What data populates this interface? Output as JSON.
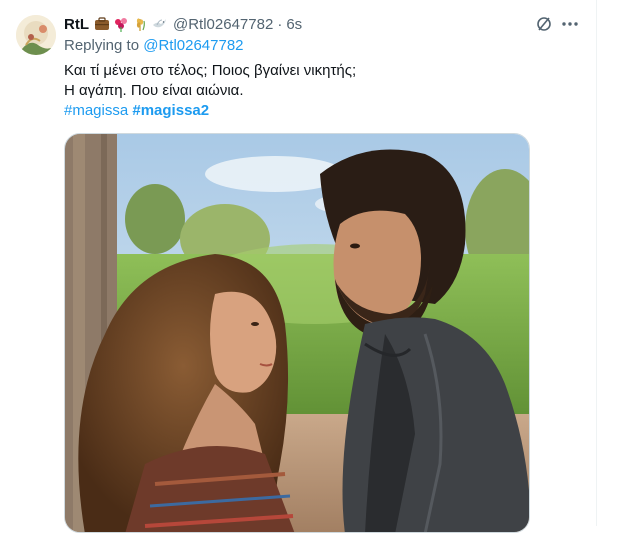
{
  "tweet": {
    "display_name": "RtL",
    "handle": "@Rtl02647782",
    "separator": "·",
    "timestamp": "6s",
    "replying_prefix": "Replying to",
    "replying_to": "@Rtl02647782",
    "text_line_1": "Και τί μένει στο τέλος; Ποιος βγαίνει νικητής;",
    "text_line_2": "Η αγάπη. Που είναι αιώνια.",
    "hashtags": [
      "#magissa",
      "#magissa2"
    ],
    "name_emojis": [
      "briefcase-emoji",
      "flowers-emoji",
      "wheat-emoji",
      "dove-emoji"
    ],
    "media_description_icon": "photo"
  },
  "colors": {
    "link": "#1d9bf0",
    "text": "#0f1419",
    "secondary": "#536471",
    "border": "#eff3f4"
  }
}
